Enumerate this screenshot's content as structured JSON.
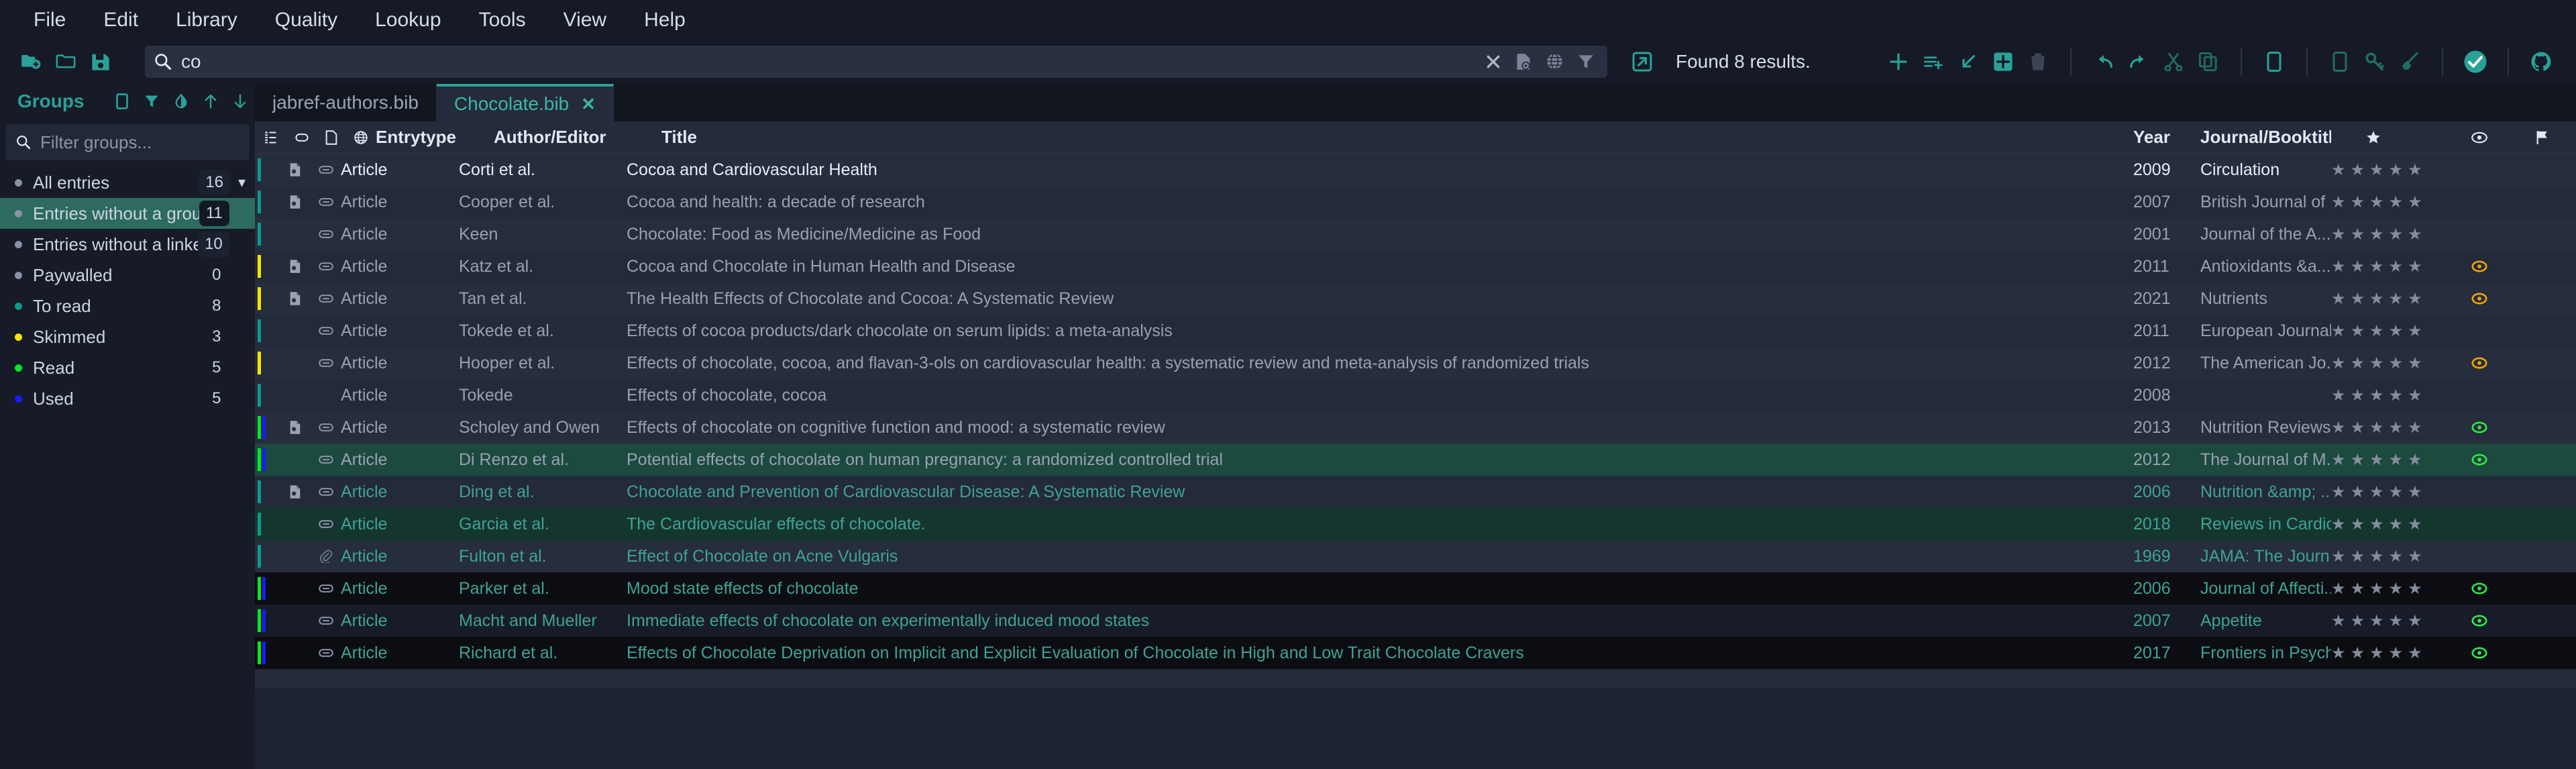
{
  "menu": {
    "items": [
      "File",
      "Edit",
      "Library",
      "Quality",
      "Lookup",
      "Tools",
      "View",
      "Help"
    ]
  },
  "toolbar": {
    "left_icons": [
      "new-library-icon",
      "open-library-icon",
      "save-library-icon"
    ],
    "search": {
      "value": "co",
      "icon": "search-icon",
      "actions": [
        "clear-search-icon",
        "fulltext-search-icon",
        "web-search-icon",
        "filter-icon"
      ]
    },
    "open_results_icon": "open-external-icon",
    "found_text": "Found 8 results.",
    "right_icons": [
      "new-entry-icon",
      "new-entry-from-plaintext-icon",
      "import-entry-icon",
      "add-entry-icon",
      "delete-entry-icon",
      "undo-icon",
      "redo-icon",
      "cut-icon",
      "copy-icon",
      "paste-icon",
      "new-article-icon",
      "lookup-key-icon",
      "cleanup-icon",
      "task-ok-icon",
      "github-icon"
    ]
  },
  "sidebar": {
    "title": "Groups",
    "header_icons": [
      "new-group-icon",
      "filter-groups-icon",
      "invert-selection-icon",
      "move-up-icon",
      "move-down-icon",
      "close-groups-icon"
    ],
    "filter_placeholder": "Filter groups...",
    "groups": [
      {
        "name": "All entries",
        "count": "16",
        "color": "#8a93a6",
        "selected": false,
        "chevron": "chevron-down-icon",
        "count_chip": true
      },
      {
        "name": "Entries without a group",
        "count": "11",
        "color": "#8a93a6",
        "selected": true,
        "count_chip": true
      },
      {
        "name": "Entries without a linked f...",
        "count": "10",
        "color": "#8a93a6",
        "selected": false,
        "count_chip": true
      },
      {
        "name": "Paywalled",
        "count": "0",
        "color": "#8a93a6",
        "selected": false,
        "count_chip": false
      },
      {
        "name": "To read",
        "count": "8",
        "color": "#0a9b8e",
        "selected": false,
        "count_chip": false
      },
      {
        "name": "Skimmed",
        "count": "3",
        "color": "#ffe500",
        "selected": false,
        "count_chip": false
      },
      {
        "name": "Read",
        "count": "5",
        "color": "#00e824",
        "selected": false,
        "count_chip": false
      },
      {
        "name": "Used",
        "count": "5",
        "color": "#1b1bff",
        "selected": false,
        "count_chip": false
      }
    ]
  },
  "tabs": [
    {
      "label": "jabref-authors.bib",
      "active": false,
      "closable": false
    },
    {
      "label": "Chocolate.bib",
      "active": true,
      "closable": true,
      "close_icon": "close-tab-icon"
    }
  ],
  "table": {
    "headers": {
      "group_icon": "group-color-icon",
      "linked_icon": "linked-identifier-icon",
      "file_icon": "file-icon",
      "url_icon": "url-icon",
      "entrytype": "Entrytype",
      "author": "Author/Editor",
      "title": "Title",
      "year": "Year",
      "journal": "Journal/Booktitle",
      "rating": "star-icon",
      "read": "eye-icon",
      "priority": "flag-icon"
    },
    "rows": [
      {
        "bars": [
          "#0a9b8e"
        ],
        "file": true,
        "link": true,
        "entrytype": "Article",
        "author": "Corti et al.",
        "title": "Cocoa and Cardiovascular Health",
        "year": "2009",
        "journal": "Circulation",
        "stars": 5,
        "eye": null,
        "style": "alt",
        "text": "bright"
      },
      {
        "bars": [
          "#0a9b8e"
        ],
        "file": true,
        "link": true,
        "entrytype": "Article",
        "author": "Cooper et al.",
        "title": "Cocoa and health: a decade of research",
        "year": "2007",
        "journal": "British Journal of ...",
        "stars": 5,
        "eye": null,
        "style": "base",
        "text": "dim"
      },
      {
        "bars": [
          "#0a9b8e"
        ],
        "file": false,
        "link": true,
        "entrytype": "Article",
        "author": "Keen",
        "title": "Chocolate: Food as Medicine/Medicine as Food",
        "year": "2001",
        "journal": "Journal of the A...",
        "stars": 5,
        "eye": null,
        "style": "alt",
        "text": "dim"
      },
      {
        "bars": [
          "#ffe500"
        ],
        "file": true,
        "link": true,
        "entrytype": "Article",
        "author": "Katz et al.",
        "title": "Cocoa and Chocolate in Human Health and Disease",
        "year": "2011",
        "journal": "Antioxidants &a...",
        "stars": 5,
        "eye": "#f0a500",
        "style": "base",
        "text": "dim"
      },
      {
        "bars": [
          "#ffe500"
        ],
        "file": true,
        "link": true,
        "entrytype": "Article",
        "author": "Tan et al.",
        "title": "The Health Effects of Chocolate and Cocoa: A Systematic Review",
        "year": "2021",
        "journal": "Nutrients",
        "stars": 5,
        "eye": "#f0a500",
        "style": "alt",
        "text": "dim"
      },
      {
        "bars": [
          "#0a9b8e"
        ],
        "file": false,
        "link": true,
        "entrytype": "Article",
        "author": "Tokede et al.",
        "title": "Effects of cocoa products/dark chocolate on serum lipids: a meta-analysis",
        "year": "2011",
        "journal": "European Journal...",
        "stars": 5,
        "eye": null,
        "style": "base",
        "text": "dim"
      },
      {
        "bars": [
          "#ffe500"
        ],
        "file": false,
        "link": true,
        "entrytype": "Article",
        "author": "Hooper et al.",
        "title": "Effects of chocolate, cocoa, and flavan-3-ols on cardiovascular health: a systematic review and meta-analysis of randomized trials",
        "year": "2012",
        "journal": "The American Jo...",
        "stars": 5,
        "eye": "#f0a500",
        "style": "alt",
        "text": "dim"
      },
      {
        "bars": [
          "#0a9b8e"
        ],
        "file": false,
        "link": false,
        "entrytype": "Article",
        "author": "Tokede",
        "title": "Effects of chocolate, cocoa",
        "year": "2008",
        "journal": "",
        "stars": 5,
        "eye": null,
        "style": "base",
        "text": "dim"
      },
      {
        "bars": [
          "#00e824",
          "#1b1bff"
        ],
        "file": true,
        "link": true,
        "entrytype": "Article",
        "author": "Scholey and Owen",
        "title": "Effects of chocolate on cognitive function and mood: a systematic review",
        "year": "2013",
        "journal": "Nutrition Reviews",
        "stars": 5,
        "eye": "#2ee84a",
        "style": "alt",
        "text": "dim"
      },
      {
        "bars": [
          "#00e824",
          "#1b1bff"
        ],
        "file": false,
        "link": true,
        "entrytype": "Article",
        "author": "Di Renzo et al.",
        "title": "Potential effects of chocolate on human pregnancy: a randomized controlled trial",
        "year": "2012",
        "journal": "The Journal of M...",
        "stars": 5,
        "eye": "#2ee84a",
        "style": "match",
        "text": "dim"
      },
      {
        "bars": [
          "#0a9b8e"
        ],
        "file": true,
        "link": true,
        "entrytype": "Article",
        "author": "Ding et al.",
        "title": "Chocolate and Prevention of Cardiovascular Disease: A Systematic Review",
        "year": "2006",
        "journal": "Nutrition &amp; ...",
        "stars": 5,
        "eye": null,
        "style": "base",
        "text": "match"
      },
      {
        "bars": [
          "#0a9b8e"
        ],
        "file": false,
        "link": true,
        "entrytype": "Article",
        "author": "Garcia et al.",
        "title": "The Cardiovascular effects of chocolate.",
        "year": "2018",
        "journal": "Reviews in Cardio...",
        "stars": 5,
        "eye": null,
        "style": "matchdim",
        "text": "match"
      },
      {
        "bars": [
          "#0a9b8e"
        ],
        "file": false,
        "link": "paperclip",
        "entrytype": "Article",
        "author": "Fulton et al.",
        "title": "Effect of Chocolate on Acne Vulgaris",
        "year": "1969",
        "journal": "JAMA: The Journ...",
        "stars": 5,
        "eye": null,
        "style": "alt",
        "text": "match"
      },
      {
        "bars": [
          "#00e824",
          "#1b1bff"
        ],
        "file": false,
        "link": true,
        "entrytype": "Article",
        "author": "Parker et al.",
        "title": "Mood state effects of chocolate",
        "year": "2006",
        "journal": "Journal of Affecti...",
        "stars": 5,
        "eye": "#2ee84a",
        "style": "dark",
        "text": "match"
      },
      {
        "bars": [
          "#00e824",
          "#1b1bff"
        ],
        "file": false,
        "link": true,
        "entrytype": "Article",
        "author": "Macht and Mueller",
        "title": "Immediate effects of chocolate on experimentally induced mood states",
        "year": "2007",
        "journal": "Appetite",
        "stars": 5,
        "eye": "#2ee84a",
        "style": "dark2",
        "text": "match"
      },
      {
        "bars": [
          "#00e824",
          "#1b1bff"
        ],
        "file": false,
        "link": true,
        "entrytype": "Article",
        "author": "Richard et al.",
        "title": "Effects of Chocolate Deprivation on Implicit and Explicit Evaluation of Chocolate in High and Low Trait Chocolate Cravers",
        "year": "2017",
        "journal": "Frontiers in Psych...",
        "stars": 5,
        "eye": "#2ee84a",
        "style": "dark",
        "text": "match"
      }
    ]
  },
  "colors": {
    "accent": "#2aa198",
    "selection": "#2d6b5f",
    "match_row": "#1c4a3e",
    "star": "#848d9f"
  }
}
